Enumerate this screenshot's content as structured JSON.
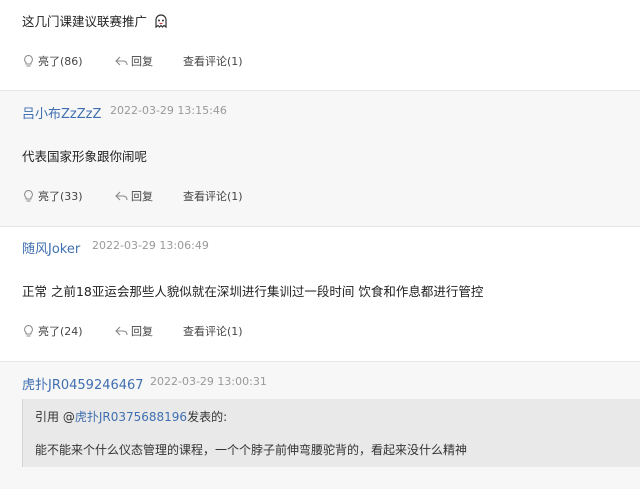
{
  "posts": [
    {
      "content": "这几门课建议联赛推广",
      "emoji_icon": "ghost-emoji",
      "actions": {
        "light_label": "亮了(86)",
        "reply_label": "回复",
        "comments_label": "查看评论(1)"
      }
    },
    {
      "author": "吕小布ZzZzZ",
      "time": "2022-03-29 13:15:46",
      "content": "代表国家形象跟你闹呢",
      "actions": {
        "light_label": "亮了(33)",
        "reply_label": "回复",
        "comments_label": "查看评论(1)"
      }
    },
    {
      "author": "随风Joker",
      "time": "2022-03-29 13:06:49",
      "content": "正常 之前18亚运会那些人貌似就在深圳进行集训过一段时间 饮食和作息都进行管控",
      "actions": {
        "light_label": "亮了(24)",
        "reply_label": "回复",
        "comments_label": "查看评论(1)"
      }
    },
    {
      "author": "虎扑JR0459246467",
      "time": "2022-03-29 13:00:31",
      "quote": {
        "prefix": "引用 @",
        "ref_user": "虎扑JR0375688196",
        "suffix": "发表的:",
        "text": "能不能来个什么仪态管理的课程，一个个脖子前伸弯腰驼背的，看起来没什么精神"
      }
    }
  ],
  "colors": {
    "link": "#3f6fb0",
    "meta": "#999999",
    "alt_bg": "#f7f7f7",
    "quote_bg": "#e9e9e9"
  }
}
